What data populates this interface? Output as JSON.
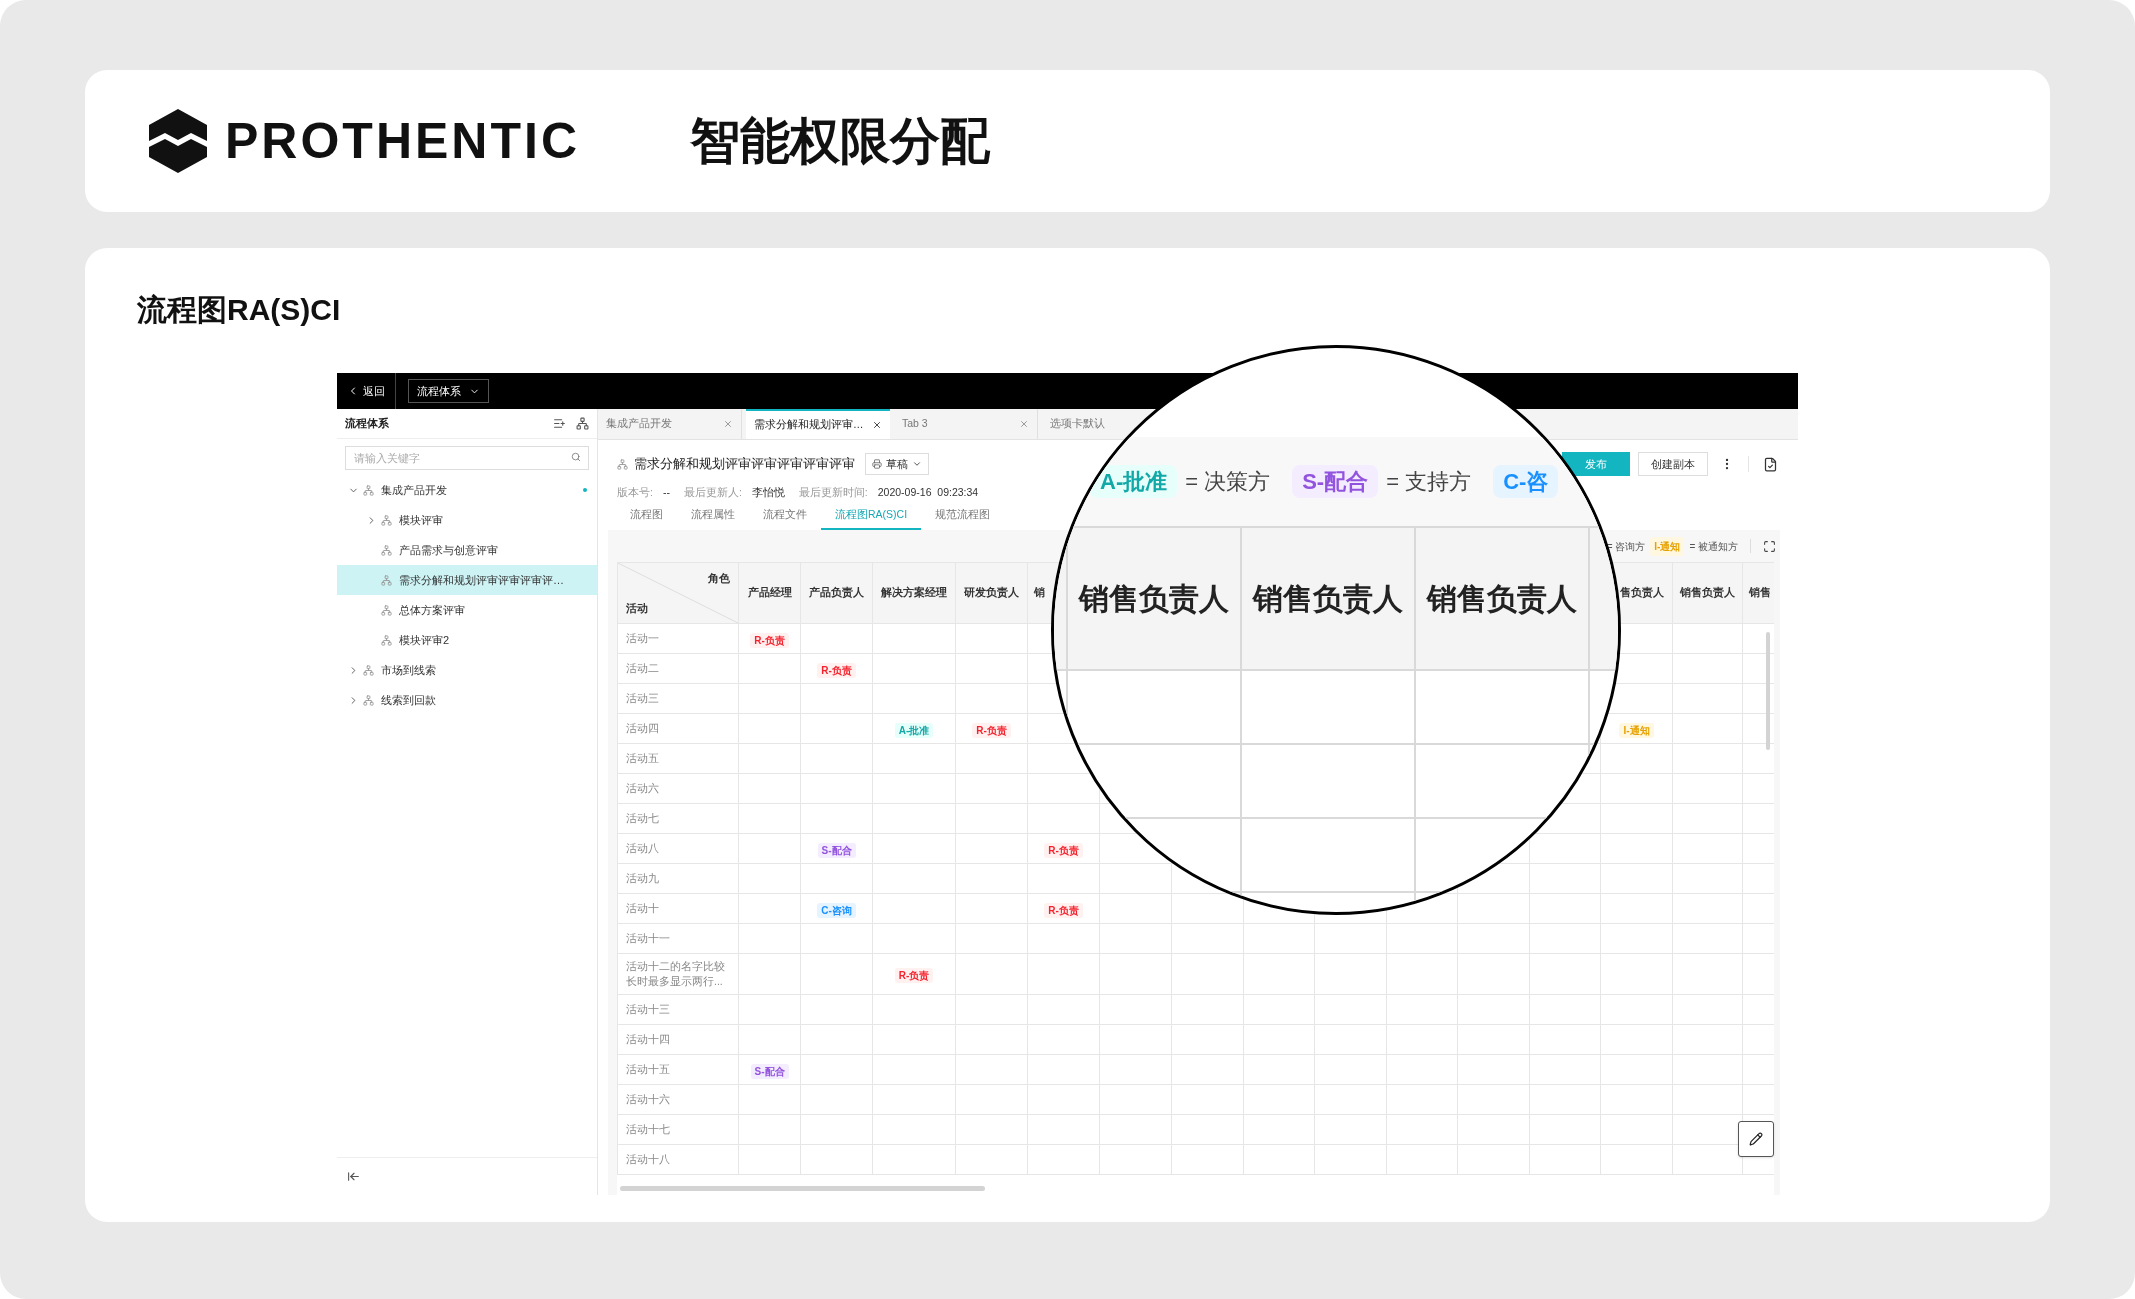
{
  "header": {
    "brand": "PROTHENTIC",
    "title": "智能权限分配"
  },
  "section": {
    "title": "流程图RA(S)CI"
  },
  "app": {
    "topbar": {
      "back": "返回",
      "system_menu": "流程体系"
    },
    "sidebar": {
      "title": "流程体系",
      "search": {
        "placeholder": "请输入关键字"
      },
      "tree": [
        {
          "label": "集成产品开发",
          "expanded": true,
          "selected": false,
          "dot": true,
          "children": [
            {
              "label": "模块评审",
              "expanded": false,
              "selected": false,
              "dot": false
            },
            {
              "label": "产品需求与创意评审",
              "selected": false,
              "dot": false
            },
            {
              "label": "需求分解和规划评审评审评审评…",
              "selected": true,
              "dot": false
            },
            {
              "label": "总体方案评审",
              "selected": false,
              "dot": false
            },
            {
              "label": "模块评审2",
              "selected": false,
              "dot": false
            }
          ]
        },
        {
          "label": "市场到线索",
          "expanded": false,
          "selected": false,
          "dot": false
        },
        {
          "label": "线索到回款",
          "expanded": false,
          "selected": false,
          "dot": false
        }
      ]
    },
    "tabs": [
      {
        "label": "集成产品开发",
        "selected": false
      },
      {
        "label": "需求分解和规划评审…",
        "selected": true
      },
      {
        "label": "Tab 3",
        "selected": false
      },
      {
        "label": "选项卡默认",
        "selected": false
      }
    ],
    "document": {
      "title": "需求分解和规划评审评审评审评审评审",
      "status": "草稿",
      "publish": "发布",
      "copy": "创建副本",
      "meta": [
        {
          "label": "版本号:",
          "value": "--"
        },
        {
          "label": "最后更新人:",
          "value": "李怡悦"
        },
        {
          "label": "最后更新时间:",
          "value": "2020-09-16  09:23:34"
        }
      ]
    },
    "subtabs": [
      {
        "label": "流程图",
        "selected": false
      },
      {
        "label": "流程属性",
        "selected": false
      },
      {
        "label": "流程文件",
        "selected": false
      },
      {
        "label": "流程图RA(S)CI",
        "selected": true
      },
      {
        "label": "规范流程图",
        "selected": false
      }
    ],
    "legend": [
      {
        "kind": "text",
        "text": "= 咨询方"
      },
      {
        "kind": "inform",
        "text": "I-通知"
      },
      {
        "kind": "text",
        "text": "= 被通知方"
      }
    ],
    "table": {
      "corner": {
        "role": "角色",
        "activity": "活动"
      },
      "columns": [
        {
          "kind": "role",
          "label": "产品经理"
        },
        {
          "kind": "role",
          "label": "产品负责人"
        },
        {
          "kind": "role",
          "label": "解决方案经理"
        },
        {
          "kind": "role",
          "label": "研发负责人"
        },
        {
          "kind": "cut_right",
          "label": "销"
        },
        {
          "kind": "covered"
        },
        {
          "kind": "covered"
        },
        {
          "kind": "covered"
        },
        {
          "kind": "covered"
        },
        {
          "kind": "covered"
        },
        {
          "kind": "covered"
        },
        {
          "kind": "covered"
        },
        {
          "kind": "cut_left",
          "label": "售负责人"
        },
        {
          "kind": "role",
          "label": "销售负责人"
        },
        {
          "kind": "cut_right",
          "label": "销售"
        }
      ],
      "rows": [
        {
          "activity": "活动一",
          "cells": [
            {
              "kind": "responsible",
              "text": "R-负责"
            },
            null,
            null,
            null,
            null,
            null,
            null,
            null,
            null,
            null,
            null,
            null,
            null,
            null,
            null
          ]
        },
        {
          "activity": "活动二",
          "cells": [
            null,
            {
              "kind": "responsible",
              "text": "R-负责"
            },
            null,
            null,
            null,
            null,
            null,
            null,
            null,
            null,
            null,
            null,
            null,
            null,
            null
          ]
        },
        {
          "activity": "活动三",
          "cells": [
            null,
            null,
            null,
            null,
            null,
            null,
            null,
            null,
            null,
            null,
            null,
            null,
            null,
            null,
            null
          ]
        },
        {
          "activity": "活动四",
          "cells": [
            null,
            null,
            {
              "kind": "approve",
              "text": "A-批准"
            },
            {
              "kind": "responsible",
              "text": "R-负责"
            },
            null,
            null,
            null,
            null,
            null,
            null,
            null,
            null,
            {
              "kind": "inform",
              "text": "I-通知"
            },
            null,
            null
          ]
        },
        {
          "activity": "活动五",
          "cells": [
            null,
            null,
            null,
            null,
            null,
            null,
            null,
            null,
            null,
            null,
            null,
            null,
            null,
            null,
            null
          ]
        },
        {
          "activity": "活动六",
          "cells": [
            null,
            null,
            null,
            null,
            null,
            null,
            null,
            null,
            null,
            null,
            null,
            null,
            null,
            null,
            null
          ]
        },
        {
          "activity": "活动七",
          "cells": [
            null,
            null,
            null,
            null,
            null,
            null,
            null,
            null,
            null,
            null,
            null,
            null,
            null,
            null,
            null
          ]
        },
        {
          "activity": "活动八",
          "cells": [
            null,
            {
              "kind": "support",
              "text": "S-配合"
            },
            null,
            null,
            {
              "kind": "responsible",
              "text": "R-负责"
            },
            null,
            null,
            null,
            null,
            null,
            null,
            null,
            null,
            null,
            null
          ]
        },
        {
          "activity": "活动九",
          "cells": [
            null,
            null,
            null,
            null,
            null,
            null,
            null,
            null,
            null,
            null,
            null,
            null,
            null,
            null,
            null
          ]
        },
        {
          "activity": "活动十",
          "cells": [
            null,
            {
              "kind": "consult",
              "text": "C-咨询"
            },
            null,
            null,
            {
              "kind": "responsible",
              "text": "R-负责"
            },
            null,
            null,
            null,
            null,
            null,
            null,
            null,
            null,
            null,
            null
          ]
        },
        {
          "activity": "活动十一",
          "cells": [
            null,
            null,
            null,
            null,
            null,
            null,
            null,
            null,
            null,
            null,
            null,
            null,
            null,
            null,
            null
          ]
        },
        {
          "activity": "活动十二的名字比较长时最多显示两行...",
          "cells": [
            null,
            null,
            {
              "kind": "responsible",
              "text": "R-负责"
            },
            null,
            null,
            null,
            null,
            null,
            null,
            null,
            null,
            null,
            null,
            null,
            null
          ]
        },
        {
          "activity": "活动十三",
          "cells": [
            null,
            null,
            null,
            null,
            null,
            null,
            null,
            null,
            null,
            null,
            null,
            null,
            null,
            null,
            null
          ]
        },
        {
          "activity": "活动十四",
          "cells": [
            null,
            null,
            null,
            null,
            null,
            null,
            null,
            null,
            null,
            null,
            null,
            null,
            null,
            null,
            null
          ]
        },
        {
          "activity": "活动十五",
          "cells": [
            {
              "kind": "support",
              "text": "S-配合"
            },
            null,
            null,
            null,
            null,
            null,
            null,
            null,
            null,
            null,
            null,
            null,
            null,
            null,
            null
          ]
        },
        {
          "activity": "活动十六",
          "cells": [
            null,
            null,
            null,
            null,
            null,
            null,
            null,
            null,
            null,
            null,
            null,
            null,
            null,
            null,
            null
          ]
        },
        {
          "activity": "活动十七",
          "cells": [
            null,
            null,
            null,
            null,
            null,
            null,
            null,
            null,
            null,
            null,
            null,
            null,
            null,
            null,
            null
          ]
        },
        {
          "activity": "活动十八",
          "cells": [
            null,
            null,
            null,
            null,
            null,
            null,
            null,
            null,
            null,
            null,
            null,
            null,
            null,
            null,
            null
          ]
        }
      ]
    }
  },
  "magnifier": {
    "legend": [
      {
        "kind": "approve",
        "text": "A-批准"
      },
      {
        "kind": "text",
        "text": "= 决策方"
      },
      {
        "kind": "support",
        "text": "S-配合"
      },
      {
        "kind": "text",
        "text": "= 支持方"
      },
      {
        "kind": "consult",
        "text": "C-咨"
      }
    ],
    "columns": [
      "销售负责人",
      "销售负责人",
      "销售负责人"
    ]
  }
}
